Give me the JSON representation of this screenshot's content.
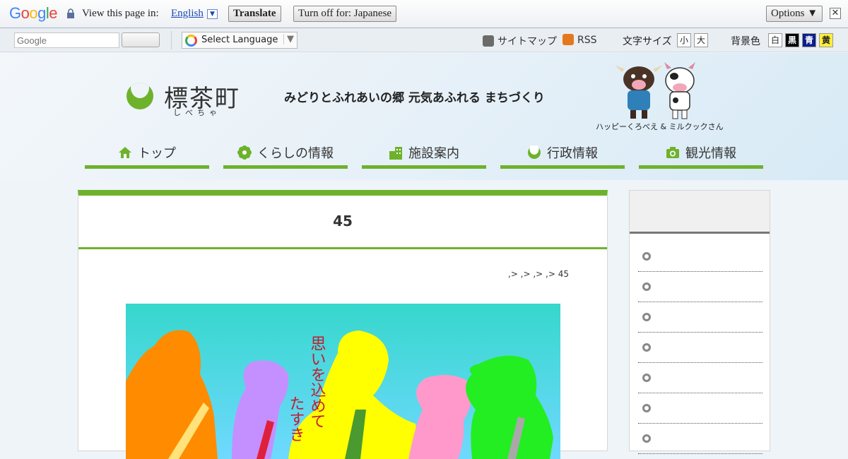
{
  "translate_bar": {
    "logo": "Google",
    "prompt": "View this page in:",
    "language": "English",
    "translate_label": "Translate",
    "turn_off_label": "Turn off for: Japanese",
    "options_label": "Options ▼",
    "close_label": "✕"
  },
  "utility": {
    "search_placeholder": "Google",
    "language_select": "Select Language",
    "language_caret": "▼",
    "sitemap_label": "サイトマップ",
    "rss_label": "RSS",
    "font_size_label": "文字サイズ",
    "font_small": "小",
    "font_large": "大",
    "bg_color_label": "背景色",
    "bg_white": "白",
    "bg_black": "黒",
    "bg_blue": "青",
    "bg_yellow": "黄"
  },
  "header": {
    "town_name": "標茶町",
    "town_kana": "しべちゃ",
    "tagline": "みどりとふれあいの郷 元気あふれる まちづくり",
    "mascot_caption": "ハッピーくろべえ & ミルクックさん"
  },
  "nav": [
    {
      "label": "トップ",
      "icon": "house-icon"
    },
    {
      "label": "くらしの情報",
      "icon": "flower-icon"
    },
    {
      "label": "施設案内",
      "icon": "building-icon"
    },
    {
      "label": "行政情報",
      "icon": "town-logo-icon"
    },
    {
      "label": "観光情報",
      "icon": "camera-icon"
    }
  ],
  "main": {
    "title": "45",
    "breadcrumb": ",> ,> ,> ,> 45"
  },
  "hero_image": {
    "vertical_text_1": "思いを込めて",
    "vertical_text_2": "たすき"
  },
  "colors": {
    "accent_green": "#6eb22c",
    "hero_bg": "#36d7cc"
  }
}
